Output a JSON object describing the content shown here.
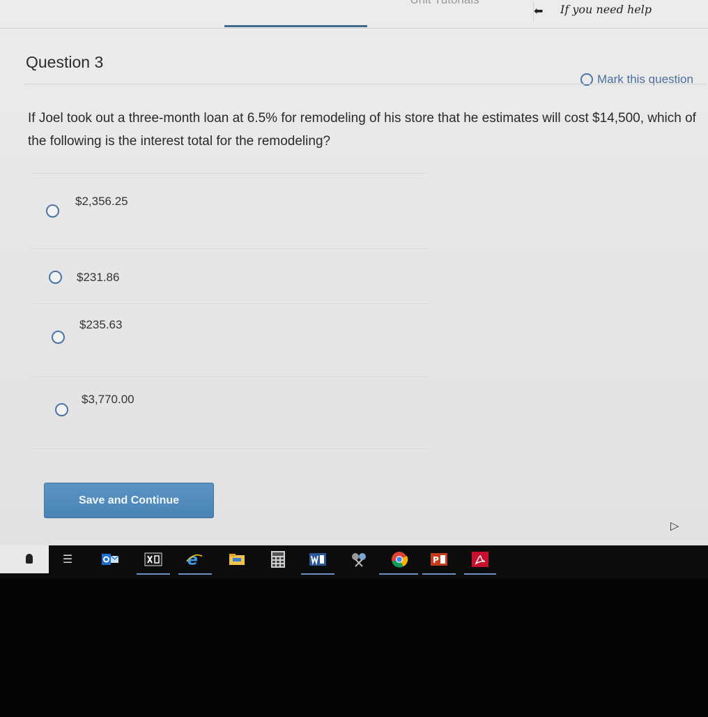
{
  "header": {
    "tutorials_label": "Unit Tutorials",
    "help_label": "If you need help"
  },
  "question": {
    "title": "Question 3",
    "mark_label": "Mark this question",
    "text": "If Joel took out a three-month loan at 6.5% for remodeling of his store that he estimates will cost $14,500, which of the following is the interest total for the remodeling?"
  },
  "answers": [
    {
      "label": "$2,356.25"
    },
    {
      "label": "$231.86"
    },
    {
      "label": "$235.63"
    },
    {
      "label": "$3,770.00"
    }
  ],
  "actions": {
    "save_label": "Save and Continue"
  },
  "colors": {
    "accent": "#4a74a6",
    "button": "#4f88bb"
  },
  "taskbar": {
    "icons": [
      "task-view-icon",
      "outlook-icon",
      "excel-icon",
      "internet-explorer-icon",
      "file-explorer-icon",
      "calculator-icon",
      "word-icon",
      "snipping-tool-icon",
      "chrome-icon",
      "powerpoint-icon",
      "acrobat-icon"
    ]
  }
}
